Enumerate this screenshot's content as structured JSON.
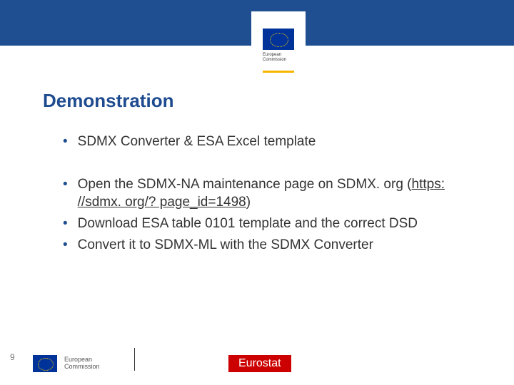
{
  "header": {
    "logo_label_line1": "European",
    "logo_label_line2": "Commission"
  },
  "title": "Demonstration",
  "bullets_group1": [
    "SDMX Converter & ESA Excel template"
  ],
  "bullets_group2": [
    {
      "pre": "Open the SDMX-NA maintenance page on SDMX. org (",
      "link": "https: //sdmx. org/? page_id=1498",
      "post": ")"
    },
    "Download ESA table 0101 template and the correct DSD",
    "Convert it to SDMX-ML with the SDMX Converter"
  ],
  "footer": {
    "page_number": "9",
    "logo_label_line1": "European",
    "logo_label_line2": "Commission",
    "eurostat_label": "Eurostat"
  }
}
